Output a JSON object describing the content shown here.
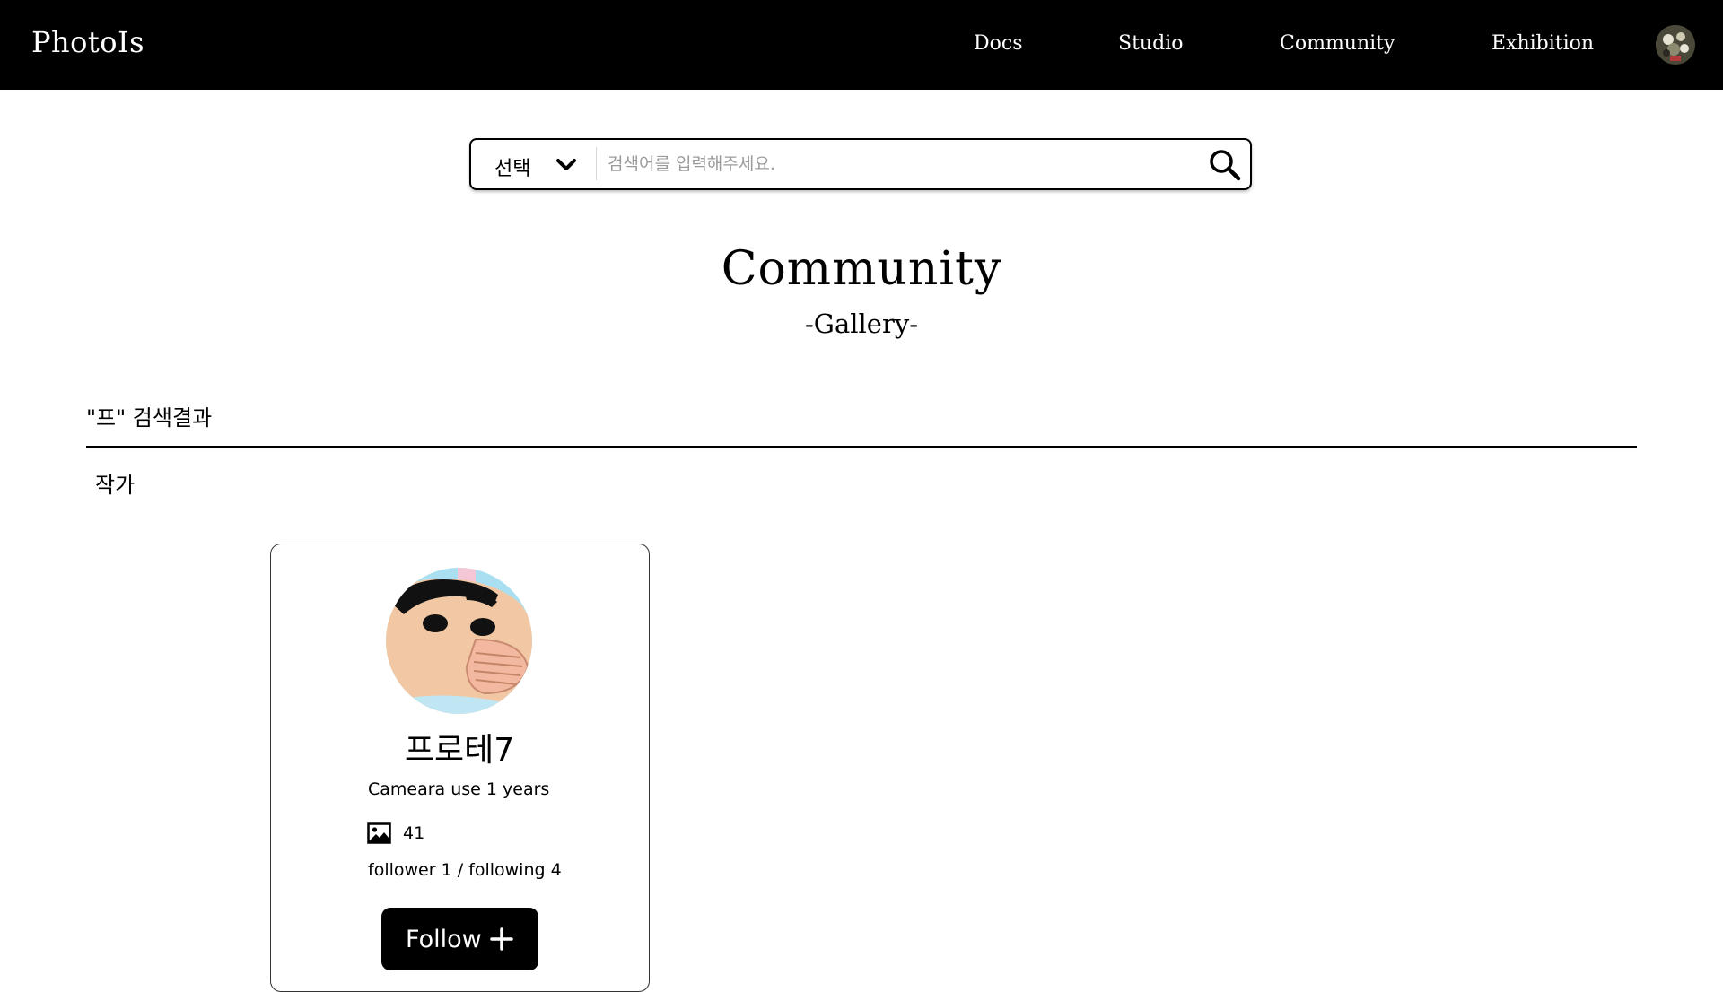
{
  "header": {
    "logo": "PhotoIs",
    "nav": [
      {
        "label": "Docs"
      },
      {
        "label": "Studio"
      },
      {
        "label": "Community"
      },
      {
        "label": "Exhibition"
      }
    ],
    "avatar_icon": "user-avatar"
  },
  "search": {
    "select_label": "선택",
    "placeholder": "검색어를 입력해주세요.",
    "value": "",
    "chevron_icon": "chevron-down-icon",
    "button_icon": "search-icon"
  },
  "page": {
    "title": "Community",
    "subtitle": "-Gallery-"
  },
  "results": {
    "heading": "\"프\" 검색결과",
    "section_label": "작가",
    "artists": [
      {
        "name": "프로테7",
        "camera_use": "Cameara use 1 years",
        "photo_count": "41",
        "follow_stats": "follower 1 / following 4",
        "follow_label": "Follow",
        "follow_icon": "plus-icon",
        "photo_icon": "image-icon"
      }
    ]
  },
  "colors": {
    "header_bg": "#000000",
    "header_text": "#ffffff",
    "button_bg": "#000000",
    "button_text": "#ffffff",
    "placeholder": "#9a9a9a"
  }
}
